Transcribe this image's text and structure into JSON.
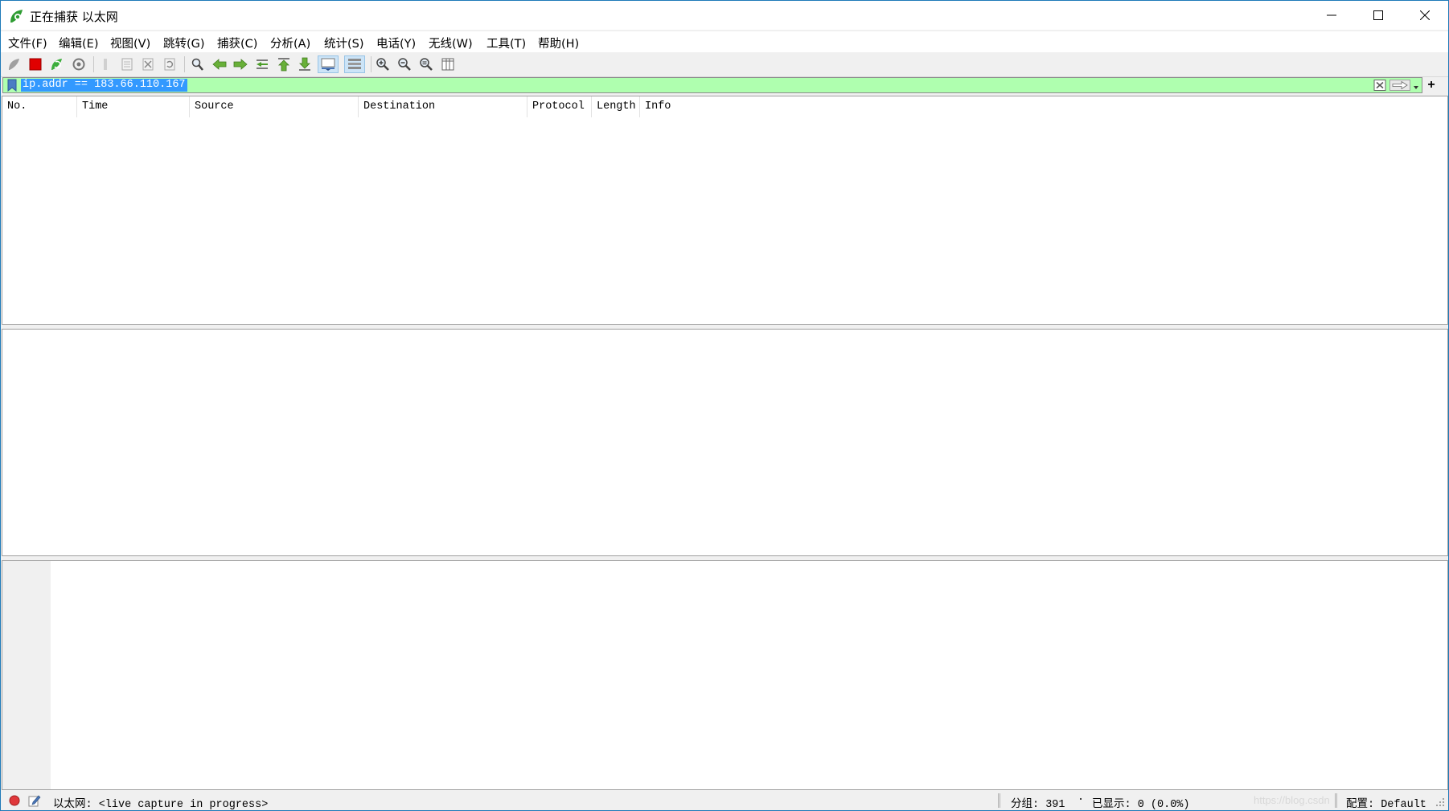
{
  "window": {
    "title": "正在捕获 以太网",
    "controls": [
      "minimize",
      "maximize",
      "close"
    ]
  },
  "menu": [
    "文件(F)",
    "编辑(E)",
    "视图(V)",
    "跳转(G)",
    "捕获(C)",
    "分析(A)",
    "统计(S)",
    "电话(Y)",
    "无线(W)",
    "工具(T)",
    "帮助(H)"
  ],
  "toolbar": {
    "icons": [
      "start-capture-icon",
      "stop-capture-icon",
      "restart-capture-icon",
      "capture-options-icon",
      "open-file-icon",
      "save-file-icon",
      "close-file-icon",
      "reload-file-icon",
      "find-packet-icon",
      "go-back-icon",
      "go-forward-icon",
      "go-to-packet-icon",
      "go-first-icon",
      "go-last-icon",
      "autoscroll-icon",
      "colorize-icon",
      "zoom-in-icon",
      "zoom-out-icon",
      "normal-size-icon",
      "resize-columns-icon"
    ]
  },
  "filter": {
    "value": "ip.addr == 183.66.110.167",
    "bg_color": "#afffaf",
    "plus": "+"
  },
  "packet_list": {
    "columns": [
      "No.",
      "Time",
      "Source",
      "Destination",
      "Protocol",
      "Length",
      "Info"
    ]
  },
  "status": {
    "capture_state": "以太网: <live capture in progress>",
    "packets": "分组: 391",
    "dot": "·",
    "displayed": "已显示: 0 (0.0%)",
    "profile": "配置: Default",
    "watermark": "https://blog.csdn"
  }
}
